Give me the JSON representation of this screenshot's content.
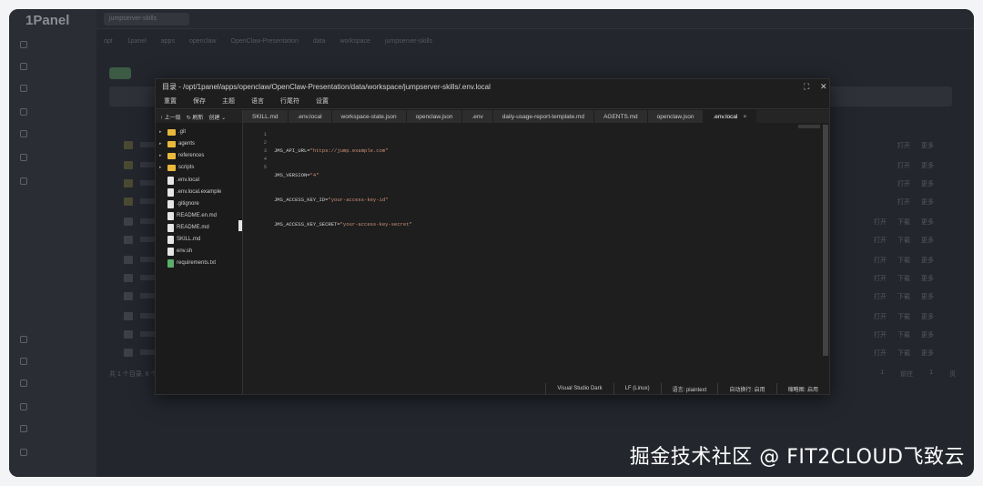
{
  "background": {
    "logo": "1Panel",
    "tab": "jumpserver-skills",
    "breadcrumb": [
      "opt",
      "1panel",
      "apps",
      "openclaw",
      "OpenClaw-Presentation",
      "data",
      "workspace",
      "jumpserver-skills"
    ],
    "row_actions": [
      "打开",
      "下载",
      "更多"
    ],
    "footer": "共 1 个目录, 8 个文件",
    "pager": [
      "1",
      "前往",
      "1",
      "页"
    ]
  },
  "modal": {
    "title": "目录 - /opt/1panel/apps/openclaw/OpenClaw-Presentation/data/workspace/jumpserver-skills/.env.local",
    "menu": [
      "重置",
      "保存",
      "主题",
      "语言",
      "行尾符",
      "设置"
    ],
    "tree_toolbar": [
      "上一级",
      "刷新",
      "创建"
    ],
    "tree": [
      {
        "name": ".git",
        "type": "folder"
      },
      {
        "name": "agents",
        "type": "folder"
      },
      {
        "name": "references",
        "type": "folder"
      },
      {
        "name": "scripts",
        "type": "folder"
      },
      {
        "name": ".env.local",
        "type": "file"
      },
      {
        "name": ".env.local.example",
        "type": "file"
      },
      {
        "name": ".gitignore",
        "type": "file"
      },
      {
        "name": "README.en.md",
        "type": "file"
      },
      {
        "name": "README.md",
        "type": "file"
      },
      {
        "name": "SKILL.md",
        "type": "file"
      },
      {
        "name": "env.sh",
        "type": "file"
      },
      {
        "name": "requirements.txt",
        "type": "file-green"
      }
    ],
    "tabs": [
      "SKILL.md",
      ".env.local",
      "workspace-state.json",
      "openclaw.json",
      ".env",
      "daily-usage-report-template.md",
      "AGENTS.md",
      "openclaw.json",
      ".env.local"
    ],
    "active_tab": ".env.local",
    "code_lines": [
      {
        "n": "1",
        "key": "JMS_API_URL=",
        "val": "\"https://jump.example.com\""
      },
      {
        "n": "2",
        "key": "JMS_VERSION=",
        "val": "\"4\""
      },
      {
        "n": "3",
        "key": "JMS_ACCESS_KEY_ID=",
        "val": "\"your-access-key-id\""
      },
      {
        "n": "4",
        "key": "JMS_ACCESS_KEY_SECRET=",
        "val": "\"your-access-key-secret\""
      },
      {
        "n": "5",
        "key": "",
        "val": ""
      }
    ],
    "status": [
      "Visual Studio Dark",
      "LF (Linux)",
      "语言: plaintext",
      "自动换行: 启用",
      "缩略图: 启用"
    ]
  },
  "watermark": "掘金技术社区 @ FIT2CLOUD飞致云"
}
